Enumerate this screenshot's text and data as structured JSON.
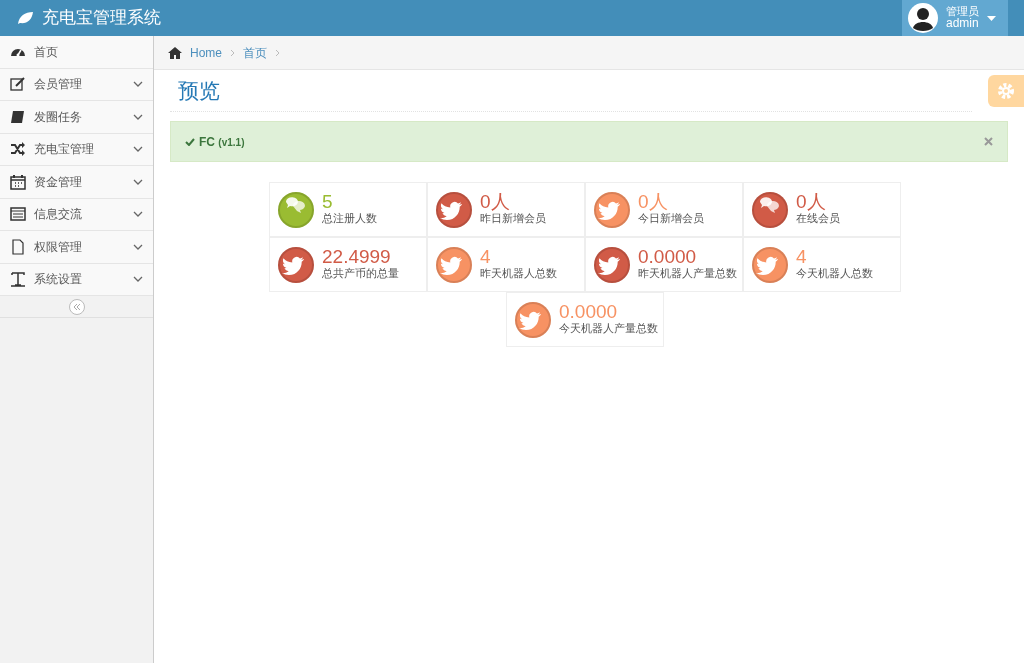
{
  "brand": "充电宝管理系统",
  "user": {
    "role": "管理员",
    "name": "admin"
  },
  "sidebar": {
    "items": [
      {
        "label": "首页",
        "expandable": false
      },
      {
        "label": "会员管理",
        "expandable": true
      },
      {
        "label": "发圈任务",
        "expandable": true
      },
      {
        "label": "充电宝管理",
        "expandable": true
      },
      {
        "label": "资金管理",
        "expandable": true
      },
      {
        "label": "信息交流",
        "expandable": true
      },
      {
        "label": "权限管理",
        "expandable": true
      },
      {
        "label": "系统设置",
        "expandable": true
      }
    ]
  },
  "breadcrumb": [
    "Home",
    "首页"
  ],
  "page_title": "预览",
  "alert": {
    "text": "FC",
    "version": "(v1.1)"
  },
  "stats": [
    [
      {
        "value": "5",
        "label": "总注册人数",
        "kind": "comments",
        "color": "#9abc32"
      },
      {
        "value": "0人",
        "label": "昨日新增会员",
        "kind": "twitter",
        "color": "#d15b47"
      },
      {
        "value": "0人",
        "label": "今日新增会员",
        "kind": "twitter",
        "color": "#f79263"
      },
      {
        "value": "0人",
        "label": "在线会员",
        "kind": "comments",
        "color": "#d15b47"
      }
    ],
    [
      {
        "value": "22.4999",
        "label": "总共产币的总量",
        "kind": "twitter",
        "color": "#d15b47"
      },
      {
        "value": "4",
        "label": "昨天机器人总数",
        "kind": "twitter",
        "color": "#f79263"
      },
      {
        "value": "0.0000",
        "label": "昨天机器人产量总数",
        "kind": "twitter",
        "color": "#d15b47"
      },
      {
        "value": "4",
        "label": "今天机器人总数",
        "kind": "twitter",
        "color": "#f79263"
      }
    ],
    [
      {
        "value": "0.0000",
        "label": "今天机器人产量总数",
        "kind": "twitter",
        "color": "#f79263"
      }
    ]
  ]
}
